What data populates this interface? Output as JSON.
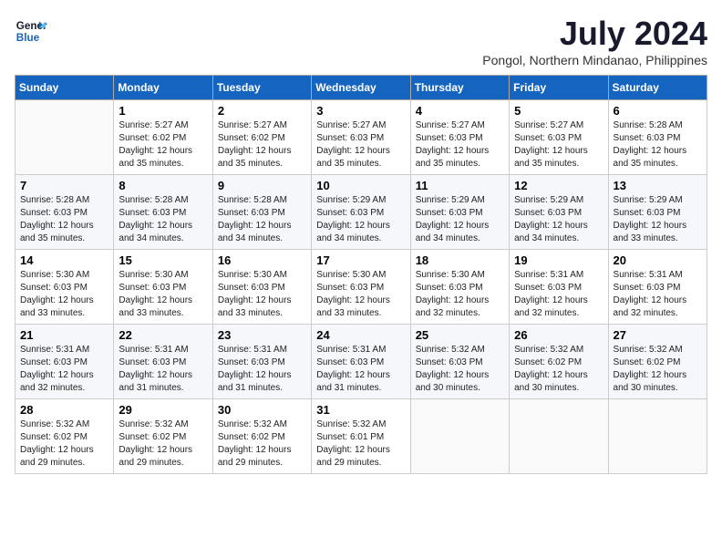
{
  "header": {
    "logo_line1": "General",
    "logo_line2": "Blue",
    "month_year": "July 2024",
    "location": "Pongol, Northern Mindanao, Philippines"
  },
  "weekdays": [
    "Sunday",
    "Monday",
    "Tuesday",
    "Wednesday",
    "Thursday",
    "Friday",
    "Saturday"
  ],
  "weeks": [
    [
      {
        "day": "",
        "sunrise": "",
        "sunset": "",
        "daylight": ""
      },
      {
        "day": "1",
        "sunrise": "Sunrise: 5:27 AM",
        "sunset": "Sunset: 6:02 PM",
        "daylight": "Daylight: 12 hours and 35 minutes."
      },
      {
        "day": "2",
        "sunrise": "Sunrise: 5:27 AM",
        "sunset": "Sunset: 6:02 PM",
        "daylight": "Daylight: 12 hours and 35 minutes."
      },
      {
        "day": "3",
        "sunrise": "Sunrise: 5:27 AM",
        "sunset": "Sunset: 6:03 PM",
        "daylight": "Daylight: 12 hours and 35 minutes."
      },
      {
        "day": "4",
        "sunrise": "Sunrise: 5:27 AM",
        "sunset": "Sunset: 6:03 PM",
        "daylight": "Daylight: 12 hours and 35 minutes."
      },
      {
        "day": "5",
        "sunrise": "Sunrise: 5:27 AM",
        "sunset": "Sunset: 6:03 PM",
        "daylight": "Daylight: 12 hours and 35 minutes."
      },
      {
        "day": "6",
        "sunrise": "Sunrise: 5:28 AM",
        "sunset": "Sunset: 6:03 PM",
        "daylight": "Daylight: 12 hours and 35 minutes."
      }
    ],
    [
      {
        "day": "7",
        "sunrise": "Sunrise: 5:28 AM",
        "sunset": "Sunset: 6:03 PM",
        "daylight": "Daylight: 12 hours and 35 minutes."
      },
      {
        "day": "8",
        "sunrise": "Sunrise: 5:28 AM",
        "sunset": "Sunset: 6:03 PM",
        "daylight": "Daylight: 12 hours and 34 minutes."
      },
      {
        "day": "9",
        "sunrise": "Sunrise: 5:28 AM",
        "sunset": "Sunset: 6:03 PM",
        "daylight": "Daylight: 12 hours and 34 minutes."
      },
      {
        "day": "10",
        "sunrise": "Sunrise: 5:29 AM",
        "sunset": "Sunset: 6:03 PM",
        "daylight": "Daylight: 12 hours and 34 minutes."
      },
      {
        "day": "11",
        "sunrise": "Sunrise: 5:29 AM",
        "sunset": "Sunset: 6:03 PM",
        "daylight": "Daylight: 12 hours and 34 minutes."
      },
      {
        "day": "12",
        "sunrise": "Sunrise: 5:29 AM",
        "sunset": "Sunset: 6:03 PM",
        "daylight": "Daylight: 12 hours and 34 minutes."
      },
      {
        "day": "13",
        "sunrise": "Sunrise: 5:29 AM",
        "sunset": "Sunset: 6:03 PM",
        "daylight": "Daylight: 12 hours and 33 minutes."
      }
    ],
    [
      {
        "day": "14",
        "sunrise": "Sunrise: 5:30 AM",
        "sunset": "Sunset: 6:03 PM",
        "daylight": "Daylight: 12 hours and 33 minutes."
      },
      {
        "day": "15",
        "sunrise": "Sunrise: 5:30 AM",
        "sunset": "Sunset: 6:03 PM",
        "daylight": "Daylight: 12 hours and 33 minutes."
      },
      {
        "day": "16",
        "sunrise": "Sunrise: 5:30 AM",
        "sunset": "Sunset: 6:03 PM",
        "daylight": "Daylight: 12 hours and 33 minutes."
      },
      {
        "day": "17",
        "sunrise": "Sunrise: 5:30 AM",
        "sunset": "Sunset: 6:03 PM",
        "daylight": "Daylight: 12 hours and 33 minutes."
      },
      {
        "day": "18",
        "sunrise": "Sunrise: 5:30 AM",
        "sunset": "Sunset: 6:03 PM",
        "daylight": "Daylight: 12 hours and 32 minutes."
      },
      {
        "day": "19",
        "sunrise": "Sunrise: 5:31 AM",
        "sunset": "Sunset: 6:03 PM",
        "daylight": "Daylight: 12 hours and 32 minutes."
      },
      {
        "day": "20",
        "sunrise": "Sunrise: 5:31 AM",
        "sunset": "Sunset: 6:03 PM",
        "daylight": "Daylight: 12 hours and 32 minutes."
      }
    ],
    [
      {
        "day": "21",
        "sunrise": "Sunrise: 5:31 AM",
        "sunset": "Sunset: 6:03 PM",
        "daylight": "Daylight: 12 hours and 32 minutes."
      },
      {
        "day": "22",
        "sunrise": "Sunrise: 5:31 AM",
        "sunset": "Sunset: 6:03 PM",
        "daylight": "Daylight: 12 hours and 31 minutes."
      },
      {
        "day": "23",
        "sunrise": "Sunrise: 5:31 AM",
        "sunset": "Sunset: 6:03 PM",
        "daylight": "Daylight: 12 hours and 31 minutes."
      },
      {
        "day": "24",
        "sunrise": "Sunrise: 5:31 AM",
        "sunset": "Sunset: 6:03 PM",
        "daylight": "Daylight: 12 hours and 31 minutes."
      },
      {
        "day": "25",
        "sunrise": "Sunrise: 5:32 AM",
        "sunset": "Sunset: 6:03 PM",
        "daylight": "Daylight: 12 hours and 30 minutes."
      },
      {
        "day": "26",
        "sunrise": "Sunrise: 5:32 AM",
        "sunset": "Sunset: 6:02 PM",
        "daylight": "Daylight: 12 hours and 30 minutes."
      },
      {
        "day": "27",
        "sunrise": "Sunrise: 5:32 AM",
        "sunset": "Sunset: 6:02 PM",
        "daylight": "Daylight: 12 hours and 30 minutes."
      }
    ],
    [
      {
        "day": "28",
        "sunrise": "Sunrise: 5:32 AM",
        "sunset": "Sunset: 6:02 PM",
        "daylight": "Daylight: 12 hours and 29 minutes."
      },
      {
        "day": "29",
        "sunrise": "Sunrise: 5:32 AM",
        "sunset": "Sunset: 6:02 PM",
        "daylight": "Daylight: 12 hours and 29 minutes."
      },
      {
        "day": "30",
        "sunrise": "Sunrise: 5:32 AM",
        "sunset": "Sunset: 6:02 PM",
        "daylight": "Daylight: 12 hours and 29 minutes."
      },
      {
        "day": "31",
        "sunrise": "Sunrise: 5:32 AM",
        "sunset": "Sunset: 6:01 PM",
        "daylight": "Daylight: 12 hours and 29 minutes."
      },
      {
        "day": "",
        "sunrise": "",
        "sunset": "",
        "daylight": ""
      },
      {
        "day": "",
        "sunrise": "",
        "sunset": "",
        "daylight": ""
      },
      {
        "day": "",
        "sunrise": "",
        "sunset": "",
        "daylight": ""
      }
    ]
  ]
}
